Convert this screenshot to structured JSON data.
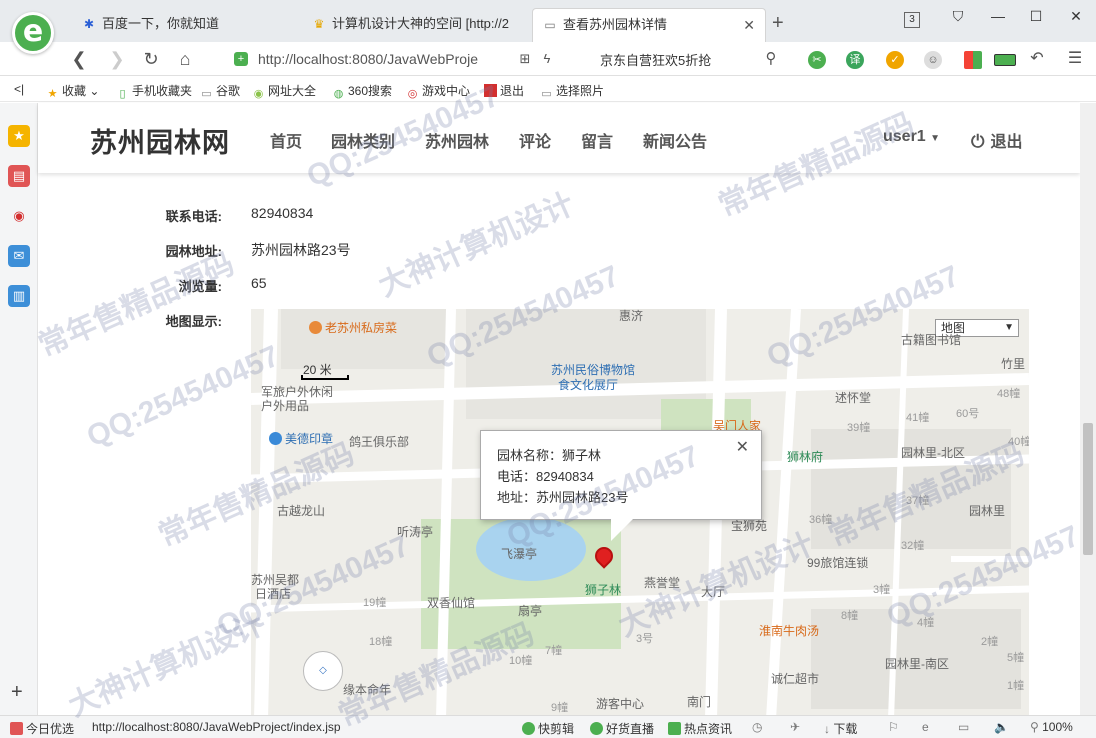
{
  "browser": {
    "tabs": [
      {
        "title": "百度一下，你就知道",
        "icon": "paw-icon"
      },
      {
        "title": "计算机设计大神的空间 [http://2",
        "icon": "crown-icon"
      },
      {
        "title": "查看苏州园林详情",
        "icon": "page-icon",
        "active": true
      }
    ],
    "tab_count": "3",
    "url": "http://localhost:8080/JavaWebProje",
    "promo": "京东自营狂欢5折抢",
    "bookmarks": [
      "收藏",
      "手机收藏夹",
      "谷歌",
      "网址大全",
      "360搜索",
      "游戏中心",
      "退出",
      "选择照片"
    ]
  },
  "site": {
    "brand": "苏州园林网",
    "nav": [
      "首页",
      "园林类别",
      "苏州园林",
      "评论",
      "留言",
      "新闻公告"
    ],
    "user": "user1",
    "logout": "退出"
  },
  "details": [
    {
      "label": "联系电话:",
      "value": "82940834"
    },
    {
      "label": "园林地址:",
      "value": "苏州园林路23号"
    },
    {
      "label": "浏览量:",
      "value": "65"
    },
    {
      "label": "地图显示:",
      "value": ""
    }
  ],
  "map": {
    "type_select": "地图",
    "scale": "20 米",
    "info": {
      "name_label": "园林名称：狮子林",
      "phone_label": "电话：82940834",
      "address_label": "地址：苏州园林路23号"
    },
    "pois": [
      "老苏州私房菜",
      "惠济",
      "苏州民俗博物馆",
      "食文化展厅",
      "古籍图书馆",
      "竹里",
      "军旅户外休闲",
      "户外用品",
      "述怀堂",
      "美德印章",
      "鸽王俱乐部",
      "吴门人家",
      "狮林府",
      "园林里-北区",
      "古越龙山",
      "听涛亭",
      "飞瀑亭",
      "宝狮苑",
      "园林里",
      "99旅馆连锁",
      "苏州吴都",
      "日酒店",
      "双香仙馆",
      "扇亭",
      "狮子林",
      "燕誉堂",
      "大厅",
      "淮南牛肉汤",
      "园林里-南区",
      "诚仁超市",
      "缘本命年",
      "游客中心",
      "南门"
    ],
    "numbers": [
      "48幢",
      "41幢",
      "60号",
      "39幢",
      "40幢",
      "37幢",
      "36幢",
      "32幢",
      "3幢",
      "8幢",
      "4幢",
      "19幢",
      "18幢",
      "10幢",
      "7幢",
      "3号",
      "9幢",
      "2幢",
      "5幢",
      "1幢"
    ]
  },
  "statusbar": {
    "left": "今日优选",
    "url": "http://localhost:8080/JavaWebProject/index.jsp",
    "items": [
      "快剪辑",
      "好货直播",
      "热点资讯",
      "下载"
    ],
    "zoom": "100%"
  },
  "watermark": {
    "qq": "QQ:254540457",
    "text1": "常年售精品源码",
    "text2": "大神计算机设计"
  },
  "colors": {
    "brand_text": "#333333",
    "map_bg": "#efeee9",
    "marker": "#e02020",
    "green": "#4caf50"
  }
}
